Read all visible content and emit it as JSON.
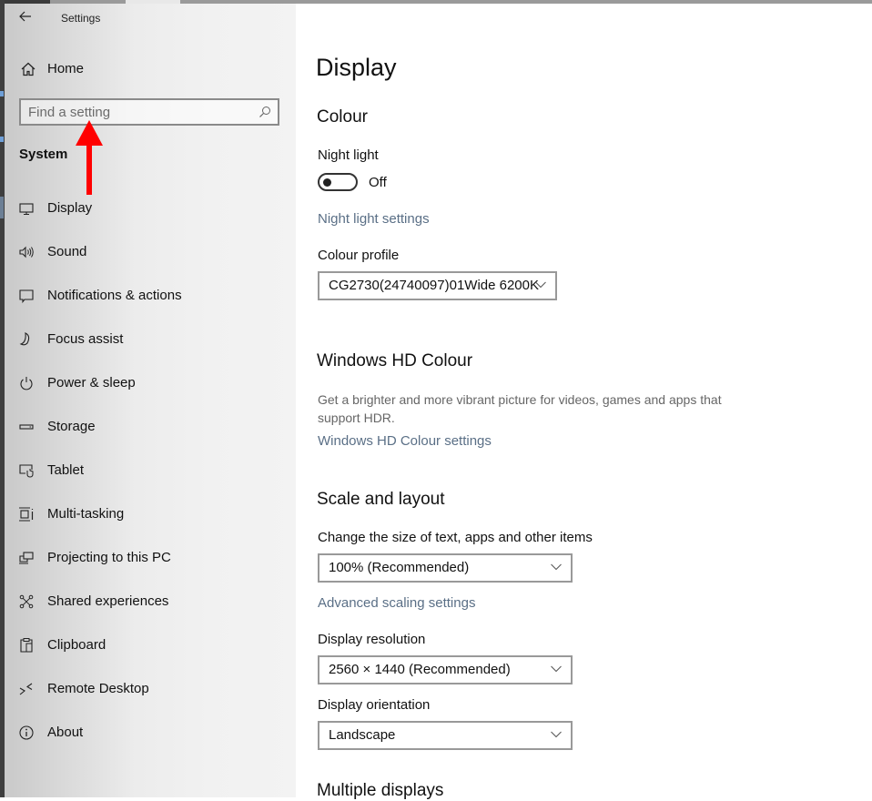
{
  "window": {
    "title": "Settings"
  },
  "sidebar": {
    "home_label": "Home",
    "search": {
      "placeholder": "Find a setting",
      "value": ""
    },
    "section_title": "System",
    "items": [
      {
        "label": "Display",
        "icon": "monitor-icon",
        "selected": true
      },
      {
        "label": "Sound",
        "icon": "speaker-icon",
        "selected": false
      },
      {
        "label": "Notifications & actions",
        "icon": "notification-icon",
        "selected": false
      },
      {
        "label": "Focus assist",
        "icon": "moon-icon",
        "selected": false
      },
      {
        "label": "Power & sleep",
        "icon": "power-icon",
        "selected": false
      },
      {
        "label": "Storage",
        "icon": "storage-icon",
        "selected": false
      },
      {
        "label": "Tablet",
        "icon": "tablet-icon",
        "selected": false
      },
      {
        "label": "Multi-tasking",
        "icon": "multitasking-icon",
        "selected": false
      },
      {
        "label": "Projecting to this PC",
        "icon": "projecting-icon",
        "selected": false
      },
      {
        "label": "Shared experiences",
        "icon": "shared-icon",
        "selected": false
      },
      {
        "label": "Clipboard",
        "icon": "clipboard-icon",
        "selected": false
      },
      {
        "label": "Remote Desktop",
        "icon": "remote-desktop-icon",
        "selected": false
      },
      {
        "label": "About",
        "icon": "info-icon",
        "selected": false
      }
    ]
  },
  "annotation": {
    "arrow_color": "#ff0000"
  },
  "main": {
    "page_title": "Display",
    "colour": {
      "heading": "Colour",
      "night_light_label": "Night light",
      "night_light_state": "Off",
      "night_light_on": false,
      "night_light_settings_link": "Night light settings",
      "colour_profile_label": "Colour profile",
      "colour_profile_value": "CG2730(24740097)01Wide 6200K"
    },
    "hd_colour": {
      "heading": "Windows HD Colour",
      "description": "Get a brighter and more vibrant picture for videos, games and apps that support HDR.",
      "link": "Windows HD Colour settings"
    },
    "scale_layout": {
      "heading": "Scale and layout",
      "size_label": "Change the size of text, apps and other items",
      "size_value": "100% (Recommended)",
      "advanced_link": "Advanced scaling settings",
      "resolution_label": "Display resolution",
      "resolution_value": "2560 × 1440 (Recommended)",
      "orientation_label": "Display orientation",
      "orientation_value": "Landscape"
    },
    "multiple_displays": {
      "heading": "Multiple displays"
    }
  },
  "colors": {
    "link": "#5a6f86",
    "selection_indicator": "#6c7f95"
  }
}
